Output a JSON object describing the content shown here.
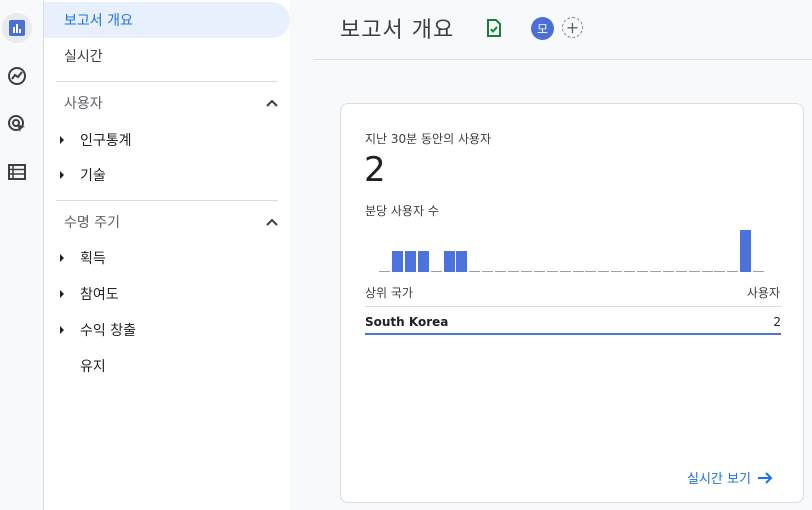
{
  "rail": {
    "icons": [
      "bar-chart-icon",
      "trending-icon",
      "target-cursor-icon",
      "list-icon"
    ]
  },
  "nav": {
    "overview": "보고서 개요",
    "realtime": "실시간",
    "user_section": "사용자",
    "demographics": "인구통계",
    "tech": "기술",
    "lifecycle_section": "수명 주기",
    "acquisition": "획득",
    "engagement": "참여도",
    "monetization": "수익 창출",
    "retention": "유지"
  },
  "header": {
    "title": "보고서 개요",
    "avatar": "모"
  },
  "card": {
    "realtime_label": "지난 30분 동안의 사용자",
    "realtime_count": "2",
    "per_minute_label": "분당 사용자 수",
    "col_country": "상위 국가",
    "col_users": "사용자",
    "rows": [
      {
        "country": "South Korea",
        "users": "2"
      }
    ],
    "link": "실시간 보기"
  },
  "chart_data": {
    "type": "bar",
    "title": "분당 사용자 수",
    "values": [
      0,
      1,
      1,
      1,
      0,
      1,
      1,
      0,
      0,
      0,
      0,
      0,
      0,
      0,
      0,
      0,
      0,
      0,
      0,
      0,
      0,
      0,
      0,
      0,
      0,
      0,
      0,
      0,
      2,
      0
    ],
    "ylim": [
      0,
      2
    ]
  },
  "colors": {
    "accent": "#1a73e8",
    "bar": "#4b72dd",
    "active_bg": "#e8f0fe"
  }
}
